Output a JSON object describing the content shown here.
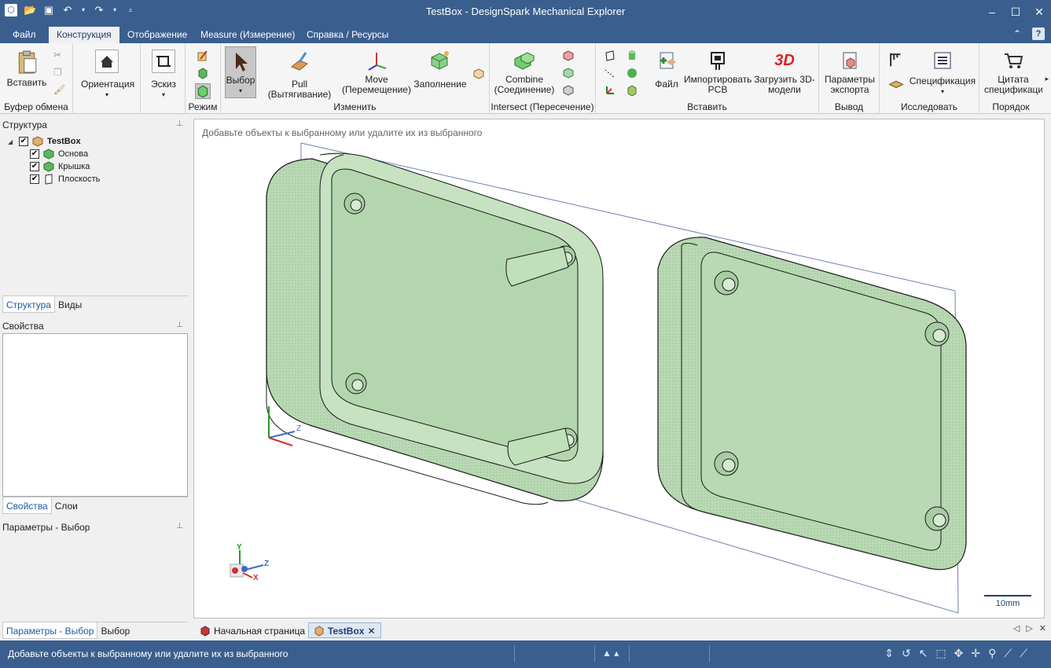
{
  "window": {
    "title": "TestBox - DesignSpark Mechanical Explorer"
  },
  "ribbon_tabs": [
    "Файл",
    "Конструкция",
    "Отображение",
    "Measure (Измерение)",
    "Справка / Ресурсы"
  ],
  "active_tab": "Конструкция",
  "ribbon": {
    "clipboard": {
      "paste": "Вставить",
      "label": "Буфер обмена"
    },
    "orientation": {
      "label": "Ориентация"
    },
    "sketch": {
      "label": "Эскиз"
    },
    "mode": {
      "label": "Режим"
    },
    "edit": {
      "select": "Выбор",
      "pull": "Pull (Вытягивание)",
      "move": "Move (Перемещение)",
      "fill": "Заполнение",
      "label": "Изменить"
    },
    "intersect": {
      "combine": "Combine (Соединение)",
      "label": "Intersect (Пересечение)"
    },
    "insert": {
      "file": "Файл",
      "pcb": "Импортировать PCB",
      "models": "Загрузить 3D-модели",
      "label": "Вставить"
    },
    "output": {
      "export": "Параметры экспорта",
      "label": "Вывод"
    },
    "investigate": {
      "spec": "Спецификация",
      "label": "Исследовать"
    },
    "order": {
      "quote": "Цитата спецификаци",
      "label": "Порядок"
    }
  },
  "structure_panel": {
    "title": "Структура",
    "tree": [
      {
        "label": "TestBox",
        "bold": true,
        "icon": "assembly-icon"
      },
      {
        "label": "Основа",
        "icon": "component-icon"
      },
      {
        "label": "Крышка",
        "icon": "component-icon"
      },
      {
        "label": "Плоскость",
        "icon": "plane-icon"
      }
    ],
    "tabs": [
      "Структура",
      "Виды"
    ]
  },
  "properties_panel": {
    "title": "Свойства",
    "tabs": [
      "Свойства",
      "Слои"
    ]
  },
  "options_panel": {
    "title": "Параметры - Выбор",
    "tabs": [
      "Параметры - Выбор",
      "Выбор"
    ]
  },
  "viewport": {
    "hint": "Добавьте объекты к выбранному или удалите их из выбранного",
    "scale": "10mm",
    "axes": {
      "x": "X",
      "y": "Y",
      "z": "Z"
    }
  },
  "doc_tabs": [
    "Начальная страница",
    "TestBox"
  ],
  "status": {
    "message": "Добавьте объекты к выбранному или удалите их из выбранного"
  },
  "colors": {
    "chrome": "#3a5f8f",
    "part_fill": "#b9d8b4",
    "part_dark": "#8fb58a"
  }
}
